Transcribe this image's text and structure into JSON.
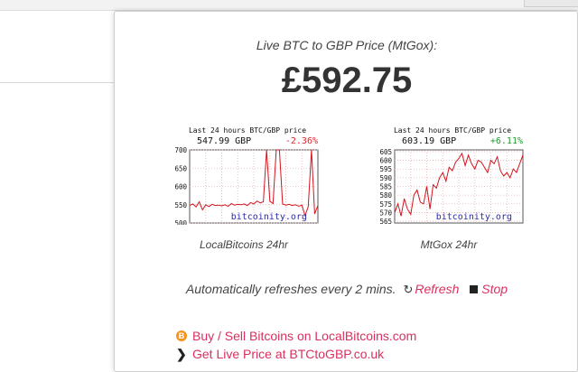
{
  "popup": {
    "subtitle": "Live BTC to GBP Price (MtGox):",
    "price": "£592.75",
    "charts": [
      {
        "header": "Last 24 hours BTC/GBP price",
        "price": "547.99 GBP",
        "change": "-2.36%",
        "change_color": "#e0242e",
        "watermark": "bitcoinity.org",
        "y_ticks": [
          "700",
          "650",
          "600",
          "550",
          "500"
        ],
        "caption": "LocalBitcoins 24hr"
      },
      {
        "header": "Last 24 hours BTC/GBP price",
        "price": "603.19 GBP",
        "change": "+6.11%",
        "change_color": "#1e9e2e",
        "watermark": "bitcoinity.org",
        "y_ticks": [
          "605",
          "600",
          "595",
          "590",
          "585",
          "580",
          "575",
          "570",
          "565"
        ],
        "caption": "MtGox 24hr"
      }
    ],
    "refresh": {
      "text": "Automatically refreshes every 2 mins.",
      "refresh_label": "Refresh",
      "stop_label": "Stop"
    },
    "links": [
      {
        "icon": "bitcoin-icon",
        "label": "Buy / Sell Bitcoins on LocalBitcoins.com"
      },
      {
        "icon": "chevron-right-icon",
        "label": "Get Live Price at BTCtoGBP.co.uk"
      }
    ]
  },
  "chart_data": [
    {
      "type": "line",
      "title": "Last 24 hours BTC/GBP price",
      "ylim": [
        500,
        700
      ],
      "x": [
        0,
        1,
        2,
        3,
        4,
        5,
        6,
        7,
        8,
        9,
        10,
        11,
        12,
        13,
        14,
        15,
        16,
        17,
        18,
        19,
        20,
        21,
        22,
        23,
        24,
        25,
        26,
        27,
        28,
        29,
        30,
        31,
        32,
        33,
        34,
        35,
        36,
        37,
        38,
        39,
        40
      ],
      "series": [
        {
          "values": [
            548,
            552,
            544,
            558,
            536,
            550,
            545,
            551,
            548,
            549,
            547,
            550,
            546,
            553,
            549,
            551,
            550,
            552,
            548,
            556,
            552,
            560,
            555,
            558,
            700,
            560,
            553,
            700,
            700,
            552,
            549,
            551,
            548,
            550,
            546,
            549,
            520,
            545,
            700,
            525,
            548
          ]
        }
      ]
    },
    {
      "type": "line",
      "title": "Last 24 hours BTC/GBP price",
      "ylim": [
        564,
        606
      ],
      "x": [
        0,
        1,
        2,
        3,
        4,
        5,
        6,
        7,
        8,
        9,
        10,
        11,
        12,
        13,
        14,
        15,
        16,
        17,
        18,
        19,
        20,
        21,
        22,
        23,
        24,
        25,
        26,
        27,
        28,
        29,
        30,
        31,
        32,
        33,
        34,
        35,
        36,
        37,
        38,
        39,
        40
      ],
      "series": [
        {
          "values": [
            570,
            575,
            568,
            578,
            572,
            569,
            580,
            583,
            576,
            575,
            585,
            572,
            586,
            584,
            590,
            593,
            588,
            596,
            594,
            599,
            601,
            604,
            597,
            603,
            598,
            595,
            600,
            599,
            596,
            593,
            600,
            598,
            602,
            594,
            591,
            593,
            590,
            595,
            593,
            598,
            603
          ]
        }
      ]
    }
  ]
}
